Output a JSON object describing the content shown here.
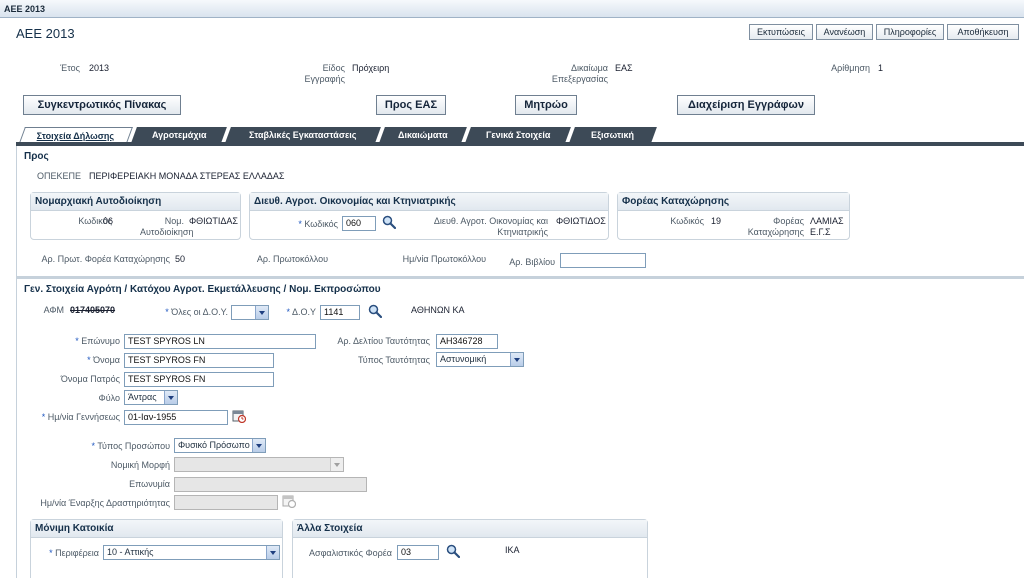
{
  "window": {
    "title": "AEE 2013"
  },
  "header": {
    "page_title": "ΑΕΕ 2013",
    "buttons": [
      "Εκτυπώσεις",
      "Ανανέωση",
      "Πληροφορίες",
      "Αποθήκευση"
    ]
  },
  "summary": {
    "year_label": "Έτος",
    "year_value": "2013",
    "doc_type_label": "Είδος Εγγραφής",
    "doc_type_value": "Πρόχειρη",
    "right_label": "Δικαίωμα Επεξεργασίας",
    "right_value": "ΕΑΣ",
    "number_label": "Αρίθμηση",
    "number_value": "1"
  },
  "actions": [
    "Συγκεντρωτικός Πίνακας",
    "Προς ΕΑΣ",
    "Μητρώο",
    "Διαχείριση Εγγράφων"
  ],
  "tabs": [
    "Στοιχεία Δήλωσης",
    "Αγροτεμάχια",
    "Σταβλικές Εγκαταστάσεις",
    "Δικαιώματα",
    "Γενικά Στοιχεία",
    "Εξισωτική"
  ],
  "to_section": {
    "title": "Προς",
    "opekepe_label": "ΟΠΕΚΕΠΕ",
    "opekepe_value": "ΠΕΡΙΦΕΡΕΙΑΚΗ ΜΟΝΑΔΑ ΣΤΕΡΕΑΣ ΕΛΛΑΔΑΣ",
    "prefecture": {
      "title": "Νομαρχιακή Αυτοδιοίκηση",
      "code_label": "Κωδικός",
      "code_value": "06",
      "name_label": "Νομ. Αυτοδιοίκηση",
      "name_value": "ΦΘΙΩΤΙΔΑΣ"
    },
    "agri_dir": {
      "title": "Διευθ. Αγροτ. Οικονομίας και Κτηνιατρικής",
      "code_label": "Κωδικός",
      "code_value": "060",
      "name_label": "Διευθ. Αγροτ. Οικονομίας και Κτηνιατρικής",
      "name_value": "ΦΘΙΩΤΙΔΟΣ"
    },
    "registry": {
      "title": "Φορέας Καταχώρησης",
      "code_label": "Κωδικός",
      "code_value": "19",
      "name_label": "Φορέας Καταχώρησης",
      "name_value": "ΛΑΜΙΑΣ Ε.Γ.Σ"
    },
    "protocol_no_label": "Αρ. Πρωτ. Φορέα Καταχώρησης",
    "protocol_no_value": "50",
    "protocol_label": "Αρ. Πρωτοκόλλου",
    "protocol_date_label": "Ημ/νία Πρωτοκόλλου",
    "book_label": "Αρ. Βιβλίου",
    "book_value": ""
  },
  "farmer": {
    "title": "Γεν. Στοιχεία Αγρότη / Κατόχου Αγροτ. Εκμετάλλευσης / Νομ. Εκπροσώπου",
    "afm_label": "ΑΦΜ",
    "afm_value": "017405070",
    "all_doy_label": "Όλες οι Δ.Ο.Υ.",
    "all_doy_value": "",
    "doy_label": "Δ.Ο.Υ",
    "doy_value": "1141",
    "doy_name": "ΑΘΗΝΩΝ ΚΑ",
    "surname_label": "Επώνυμο",
    "surname_value": "TEST SPYROS LN",
    "id_card_label": "Αρ. Δελτίου Ταυτότητας",
    "id_card_value": "ΑΗ346728",
    "name_label": "Όνομα",
    "name_value": "TEST SPYROS FN",
    "id_type_label": "Τύπος Ταυτότητας",
    "id_type_value": "Αστυνομική",
    "father_label": "Όνομα Πατρός",
    "father_value": "TEST SPYROS FN",
    "sex_label": "Φύλο",
    "sex_value": "Άντρας",
    "birth_label": "Ημ/νία Γεννήσεως",
    "birth_value": "01-Ιαν-1955",
    "person_type_label": "Τύπος Προσώπου",
    "person_type_value": "Φυσικό Πρόσωπο",
    "legal_form_label": "Νομική Μορφή",
    "legal_form_value": "",
    "company_label": "Επωνυμία",
    "company_value": "",
    "start_date_label": "Ημ/νία Έναρξης Δραστηριότητας",
    "start_date_value": ""
  },
  "residence": {
    "title": "Μόνιμη Κατοικία",
    "region_label": "Περιφέρεια",
    "region_value": "10 - Αττικής"
  },
  "other": {
    "title": "Άλλα Στοιχεία",
    "insurance_label": "Ασφαλιστικός Φορέα",
    "insurance_value": "03",
    "insurance_name": "ΙΚΑ"
  }
}
